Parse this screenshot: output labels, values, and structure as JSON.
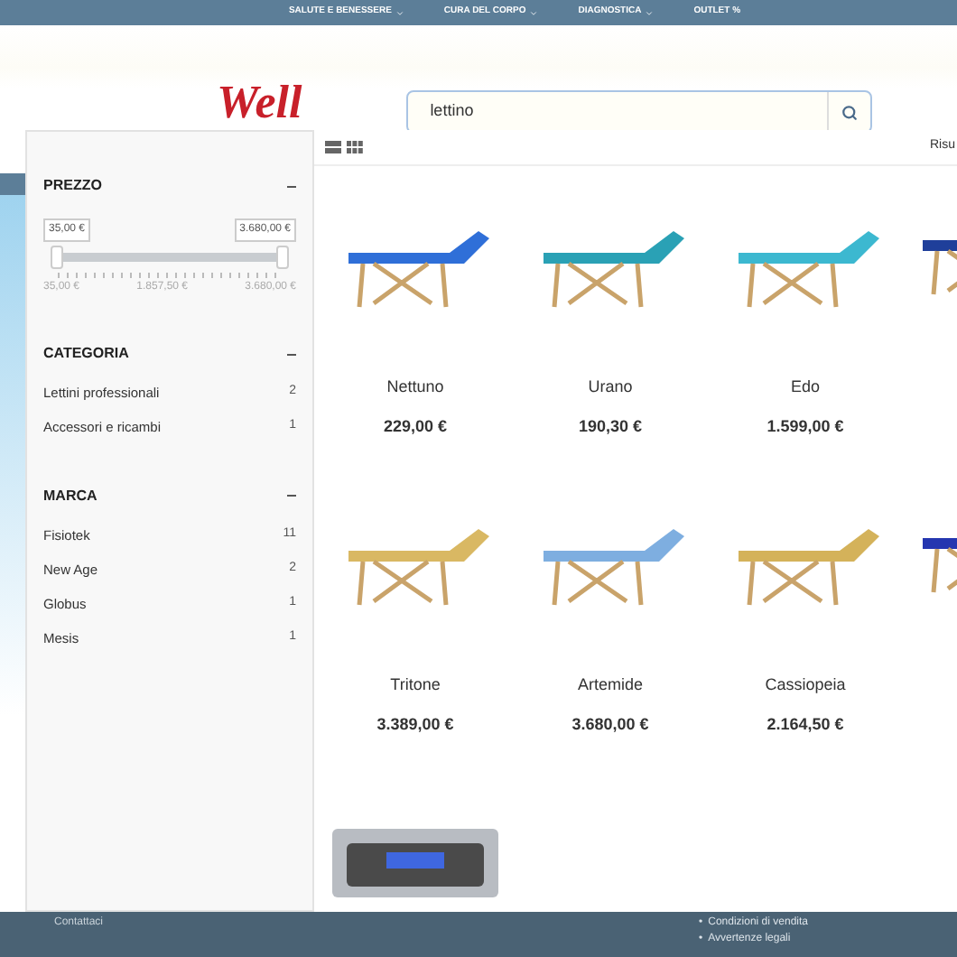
{
  "top_nav": [
    {
      "label": "SALUTE E BENESSERE",
      "has_menu": true
    },
    {
      "label": "CURA DEL CORPO",
      "has_menu": true
    },
    {
      "label": "DIAGNOSTICA",
      "has_menu": true
    },
    {
      "label": "OUTLET %",
      "has_menu": false
    }
  ],
  "logo": {
    "text": "Well"
  },
  "search": {
    "value": "lettino"
  },
  "filters": {
    "price": {
      "title": "PREZZO",
      "min_value": "35,00 €",
      "max_value": "3.680,00 €",
      "scale": [
        "35,00 €",
        "1.857,50 €",
        "3.680,00 €"
      ]
    },
    "groups": [
      {
        "title": "CATEGORIA",
        "items": [
          {
            "label": "Lettini professionali",
            "count": "2"
          },
          {
            "label": "Accessori e ricambi",
            "count": "1"
          }
        ]
      },
      {
        "title": "MARCA",
        "items": [
          {
            "label": "Fisiotek",
            "count": "11"
          },
          {
            "label": "New Age",
            "count": "2"
          },
          {
            "label": "Globus",
            "count": "1"
          },
          {
            "label": "Mesis",
            "count": "1"
          }
        ]
      }
    ]
  },
  "results": {
    "label": "Risu"
  },
  "products": [
    {
      "kind": "table",
      "color": "#2f6fd8",
      "name": "Nettuno",
      "price": "229,00 €"
    },
    {
      "kind": "table",
      "color": "#2aa1b5",
      "name": "Urano",
      "price": "190,30 €"
    },
    {
      "kind": "table",
      "color": "#3cb8d0",
      "name": "Edo",
      "price": "1.599,00 €"
    },
    {
      "kind": "table",
      "color": "#1f3f9a"
    },
    {
      "kind": "table",
      "color": "#d9b863",
      "name": "Tritone",
      "price": "3.389,00 €"
    },
    {
      "kind": "table",
      "color": "#7eaee0",
      "name": "Artemide",
      "price": "3.680,00 €"
    },
    {
      "kind": "table",
      "color": "#d4b25a",
      "name": "Cassiopeia",
      "price": "2.164,50 €"
    },
    {
      "kind": "table",
      "color": "#2536b0"
    },
    {
      "kind": "device"
    }
  ],
  "footer": {
    "links": [
      "Contattaci"
    ],
    "bullet": "•",
    "legal": [
      "Condizioni di vendita",
      "Avvertenze legali"
    ]
  }
}
